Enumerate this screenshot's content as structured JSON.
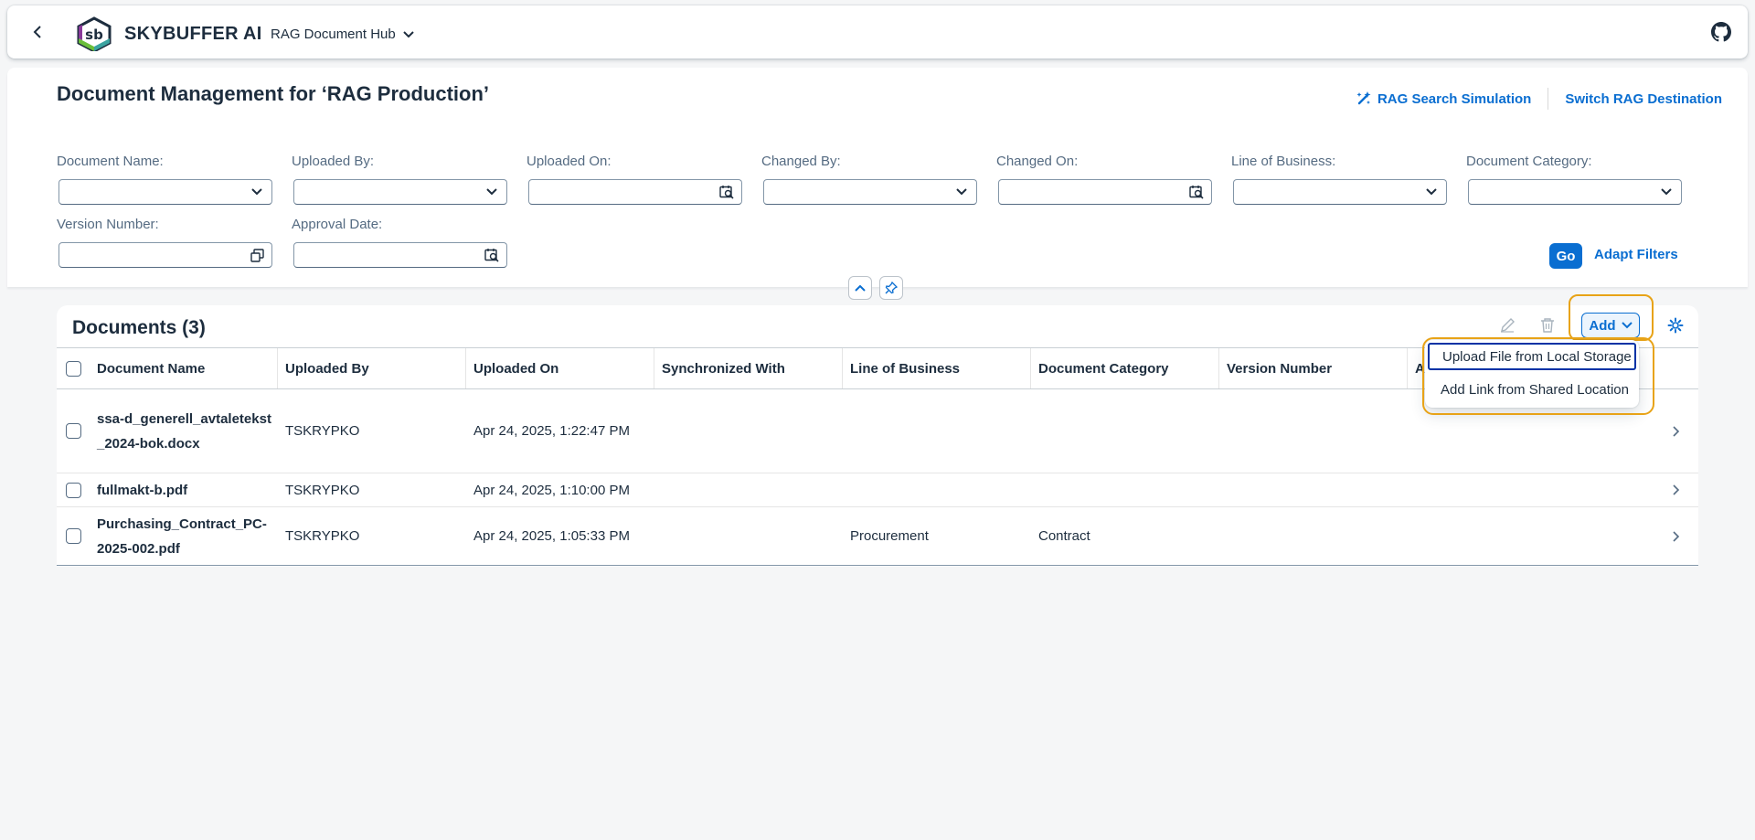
{
  "shellbar": {
    "brand": "SKYBUFFER AI",
    "logo_text": "sb",
    "app_title": "RAG Document Hub"
  },
  "page": {
    "title": "Document Management for ‘RAG Production’",
    "actions": {
      "search_simulation": "RAG Search Simulation",
      "switch_destination": "Switch RAG Destination"
    }
  },
  "filters": {
    "document_name": {
      "label": "Document Name:",
      "value": ""
    },
    "uploaded_by": {
      "label": "Uploaded By:",
      "value": ""
    },
    "uploaded_on": {
      "label": "Uploaded On:",
      "value": ""
    },
    "changed_by": {
      "label": "Changed By:",
      "value": ""
    },
    "changed_on": {
      "label": "Changed On:",
      "value": ""
    },
    "line_of_business": {
      "label": "Line of Business:",
      "value": ""
    },
    "document_category": {
      "label": "Document Category:",
      "value": ""
    },
    "version_number": {
      "label": "Version Number:",
      "value": ""
    },
    "approval_date": {
      "label": "Approval Date:",
      "value": ""
    },
    "go_label": "Go",
    "adapt_label": "Adapt Filters"
  },
  "table": {
    "title": "Documents (3)",
    "add_label": "Add",
    "columns": [
      "Document Name",
      "Uploaded By",
      "Uploaded On",
      "Synchronized With",
      "Line of Business",
      "Document Category",
      "Version Number",
      "A"
    ],
    "rows": [
      {
        "name": "ssa-d_generell_avtaletekst_2024-bok.docx",
        "uploaded_by": "TSKRYPKO",
        "uploaded_on": "Apr 24, 2025, 1:22:47 PM",
        "synced": "",
        "lob": "",
        "category": "",
        "version": ""
      },
      {
        "name": "fullmakt-b.pdf",
        "uploaded_by": "TSKRYPKO",
        "uploaded_on": "Apr 24, 2025, 1:10:00 PM",
        "synced": "",
        "lob": "",
        "category": "",
        "version": ""
      },
      {
        "name": "Purchasing_Contract_PC-2025-002.pdf",
        "uploaded_by": "TSKRYPKO",
        "uploaded_on": "Apr 24, 2025, 1:05:33 PM",
        "synced": "",
        "lob": "Procurement",
        "category": "Contract",
        "version": ""
      }
    ]
  },
  "add_menu": {
    "items": [
      "Upload File from Local Storage",
      "Add Link from Shared Location"
    ]
  },
  "icons": {
    "back": "chevron-left-icon",
    "github": "github-icon",
    "calendar": "calendar-icon",
    "dropdown": "chevron-down-icon",
    "value_help": "value-help-icon",
    "edit": "edit-icon",
    "delete": "delete-icon",
    "settings": "gear-icon",
    "collapse": "chevron-up-icon",
    "pin": "pin-icon",
    "navigate": "chevron-right-icon"
  },
  "colors": {
    "accent": "#0a6ed1",
    "highlight": "#e8a317",
    "focus": "#0032a5",
    "text": "#1d2d3e"
  }
}
